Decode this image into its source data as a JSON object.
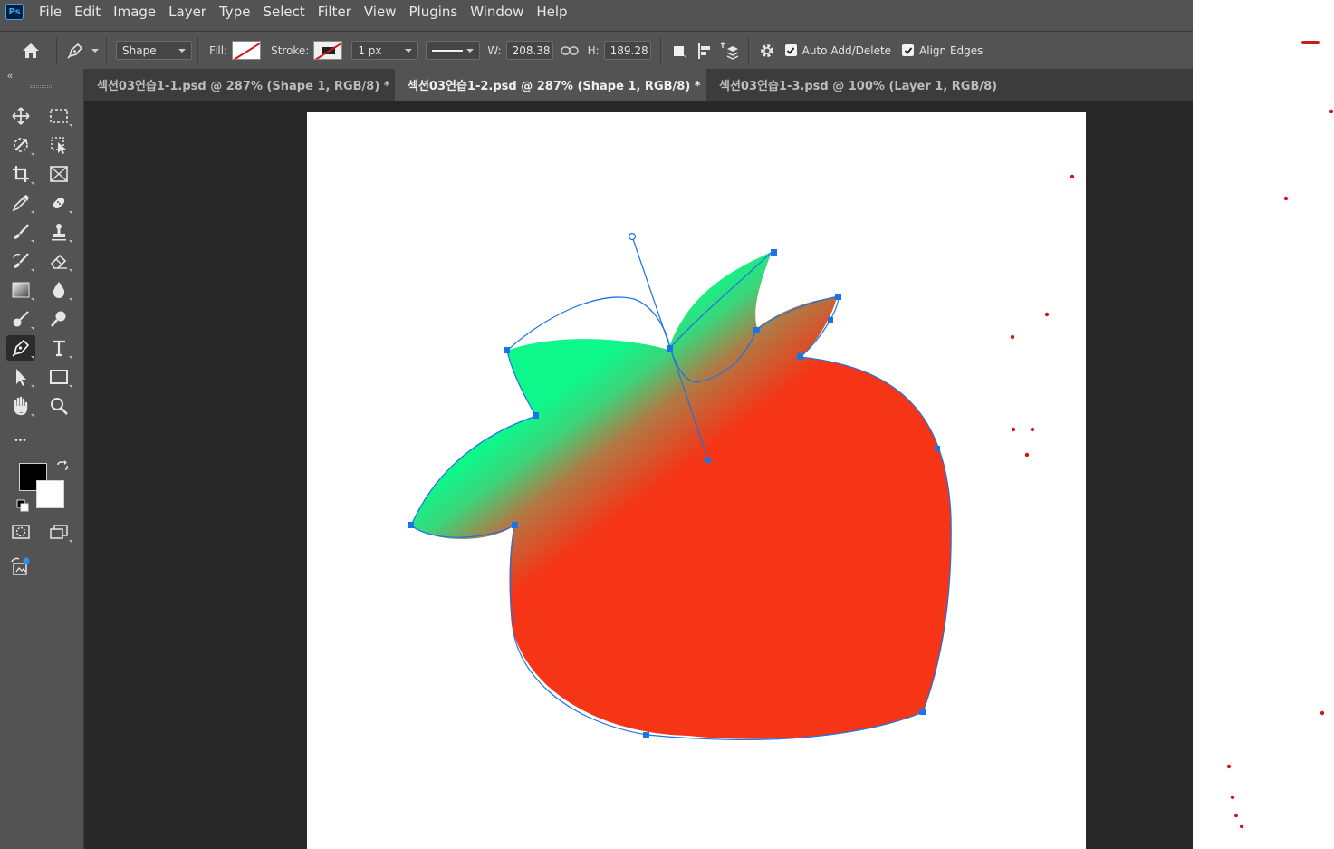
{
  "app": {
    "logo": "Ps"
  },
  "menu": [
    "File",
    "Edit",
    "Image",
    "Layer",
    "Type",
    "Select",
    "Filter",
    "View",
    "Plugins",
    "Window",
    "Help"
  ],
  "options": {
    "mode": "Shape",
    "fill_label": "Fill:",
    "stroke_label": "Stroke:",
    "stroke_width": "1 px",
    "w_label": "W:",
    "w_value": "208.38",
    "h_label": "H:",
    "h_value": "189.28",
    "auto_add_delete": "Auto Add/Delete",
    "align_edges": "Align Edges",
    "auto_add_delete_checked": true,
    "align_edges_checked": true
  },
  "tabs": [
    {
      "label": "섹션03연습1-1.psd @ 287% (Shape 1, RGB/8) *",
      "active": false
    },
    {
      "label": "섹션03연습1-2.psd @ 287% (Shape 1, RGB/8) *",
      "active": true
    },
    {
      "label": "섹션03연습1-3.psd @ 100% (Layer 1, RGB/8)",
      "active": false
    }
  ],
  "tab_close_glyph": "×",
  "toolbar": {
    "collapse_glyph": "«",
    "more_glyph": "•••",
    "active_tool": "pen-tool",
    "foreground_color": "#000000",
    "background_color": "#ffffff"
  },
  "colors": {
    "chrome": "#535353",
    "doc_background": "#282828",
    "path_blue": "#1a73e8",
    "apple_red": "#f53516",
    "leaf_green": "#0ef78a"
  }
}
